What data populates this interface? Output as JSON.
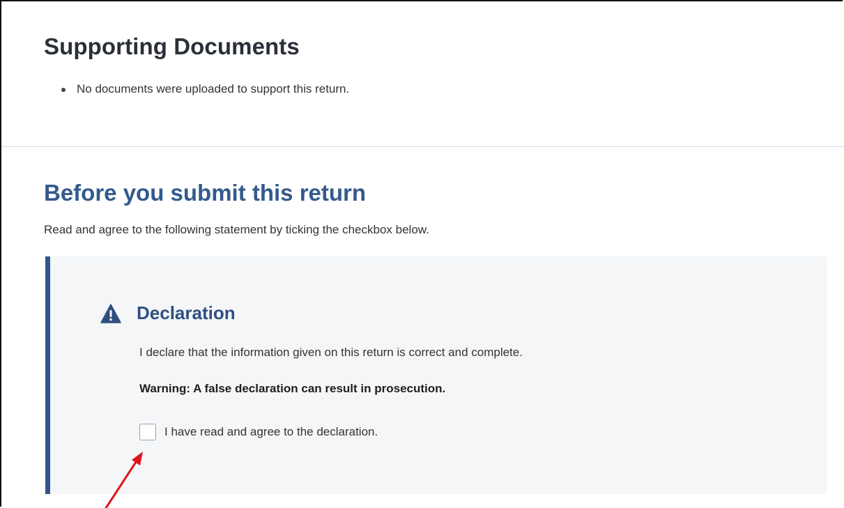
{
  "supporting": {
    "title": "Supporting Documents",
    "items": [
      "No documents were uploaded to support this return."
    ]
  },
  "submit": {
    "title": "Before you submit this return",
    "intro": "Read and agree to the following statement by ticking the checkbox below."
  },
  "declaration": {
    "icon": "warning-triangle-icon",
    "title": "Declaration",
    "text": "I declare that the information given on this return is correct and complete.",
    "warning": "Warning: A false declaration can result in prosecution.",
    "checkbox_label": "I have read and agree to the declaration.",
    "checkbox_checked": false
  },
  "colors": {
    "heading_blue": "#335a8d",
    "callout_border": "#33568a",
    "callout_bg": "#f4f6f8",
    "annotation_arrow": "#e0141e"
  }
}
